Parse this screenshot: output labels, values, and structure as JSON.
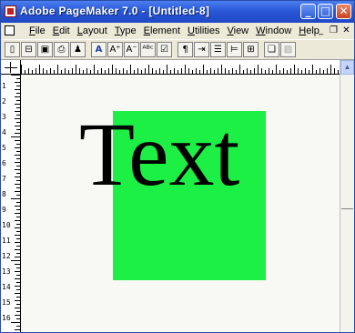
{
  "window": {
    "title": "Adobe PageMaker 7.0 - [Untitled-8]",
    "app_icon": "pagemaker-icon",
    "controls": {
      "minimize": "_",
      "maximize": "□",
      "close": "✕"
    }
  },
  "menubar": {
    "doc_icon": "document-icon",
    "items": [
      {
        "label": "File"
      },
      {
        "label": "Edit"
      },
      {
        "label": "Layout"
      },
      {
        "label": "Type"
      },
      {
        "label": "Element"
      },
      {
        "label": "Utilities"
      },
      {
        "label": "View"
      },
      {
        "label": "Window"
      },
      {
        "label": "Help"
      }
    ],
    "mdi": {
      "minimize": "_",
      "restore": "❐",
      "close": "✕"
    }
  },
  "toolbar": {
    "buttons": [
      {
        "icon": "new-icon",
        "glyph": "▯"
      },
      {
        "icon": "open-icon",
        "glyph": "⊟"
      },
      {
        "icon": "save-icon",
        "glyph": "▣"
      },
      {
        "icon": "print-icon",
        "glyph": "⎙"
      },
      {
        "icon": "find-icon",
        "glyph": "♟"
      },
      {
        "icon": "text-tool-icon",
        "glyph": "A"
      },
      {
        "icon": "font-size-up-icon",
        "glyph": "A⁺"
      },
      {
        "icon": "font-size-down-icon",
        "glyph": "A⁻"
      },
      {
        "icon": "spelling-icon",
        "glyph": "ᴬᴮᶜ"
      },
      {
        "icon": "styles-icon",
        "glyph": "☑"
      },
      {
        "icon": "paragraph-icon",
        "glyph": "¶"
      },
      {
        "icon": "indents-icon",
        "glyph": "⇥"
      },
      {
        "icon": "bullets-icon",
        "glyph": "☰"
      },
      {
        "icon": "align-icon",
        "glyph": "⊨"
      },
      {
        "icon": "frame-icon",
        "glyph": "⊞"
      },
      {
        "icon": "story-editor-icon",
        "glyph": "❏"
      },
      {
        "icon": "disabled-tool-icon",
        "glyph": "▨"
      }
    ]
  },
  "rulers": {
    "vertical_labels": [
      "1",
      "2",
      "3",
      "4",
      "5",
      "6",
      "7",
      "8",
      "9",
      "10",
      "11",
      "12",
      "13",
      "14",
      "15",
      "16"
    ]
  },
  "document": {
    "text": "Text",
    "frame_color": "#1cf044",
    "text_color": "#000000"
  },
  "scrollbar": {
    "up_arrow_icon": "scroll-up-icon",
    "up_glyph": "▲"
  }
}
